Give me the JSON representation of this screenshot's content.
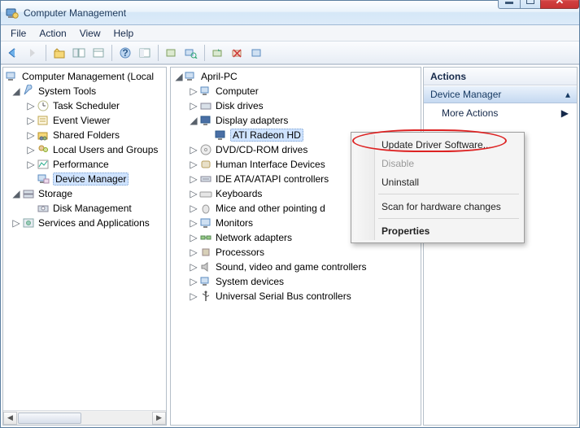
{
  "title": "Computer Management",
  "menu": {
    "file": "File",
    "action": "Action",
    "view": "View",
    "help": "Help"
  },
  "leftTree": {
    "root": "Computer Management (Local",
    "st": "System Tools",
    "ts": "Task Scheduler",
    "ev": "Event Viewer",
    "sf": "Shared Folders",
    "lug": "Local Users and Groups",
    "perf": "Performance",
    "dm": "Device Manager",
    "storage": "Storage",
    "diskm": "Disk Management",
    "sa": "Services and Applications"
  },
  "midTree": {
    "root": "April-PC",
    "comp": "Computer",
    "disk": "Disk drives",
    "disp": "Display adapters",
    "gpu": "ATI Radeon HD",
    "dvd": "DVD/CD-ROM drives",
    "hid": "Human Interface Devices",
    "ide": "IDE ATA/ATAPI controllers",
    "kb": "Keyboards",
    "mouse": "Mice and other pointing d",
    "mon": "Monitors",
    "net": "Network adapters",
    "proc": "Processors",
    "sound": "Sound, video and game controllers",
    "sys": "System devices",
    "usb": "Universal Serial Bus controllers"
  },
  "actions": {
    "hdr": "Actions",
    "group": "Device Manager",
    "more": "More Actions"
  },
  "ctx": {
    "update": "Update Driver Software...",
    "disable": "Disable",
    "uninstall": "Uninstall",
    "scan": "Scan for hardware changes",
    "props": "Properties"
  }
}
